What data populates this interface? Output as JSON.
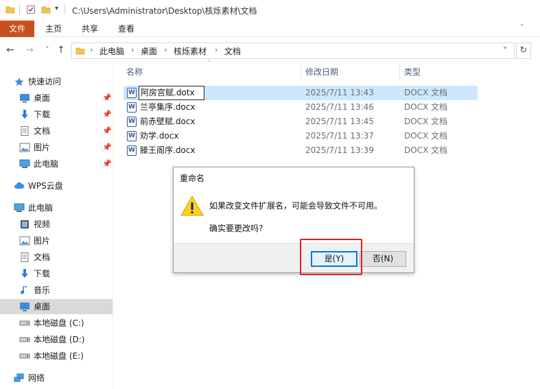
{
  "window": {
    "title_path": "C:\\Users\\Administrator\\Desktop\\核烁素材\\文档"
  },
  "ribbon": {
    "tabs": [
      "文件",
      "主页",
      "共享",
      "查看"
    ]
  },
  "address": {
    "crumbs": [
      "此电脑",
      "桌面",
      "核烁素材",
      "文档"
    ]
  },
  "sidebar": {
    "items": [
      {
        "label": "快速访问",
        "icon": "star-icon",
        "pinned": false
      },
      {
        "label": "桌面",
        "icon": "desktop-icon",
        "pinned": true
      },
      {
        "label": "下载",
        "icon": "download-icon",
        "pinned": true
      },
      {
        "label": "文档",
        "icon": "document-icon",
        "pinned": true
      },
      {
        "label": "图片",
        "icon": "picture-icon",
        "pinned": true
      },
      {
        "label": "此电脑",
        "icon": "computer-icon",
        "pinned": true
      },
      {
        "label": "WPS云盘",
        "icon": "cloud-icon",
        "pinned": false
      },
      {
        "label": "此电脑",
        "icon": "computer-icon",
        "pinned": false
      },
      {
        "label": "视频",
        "icon": "video-icon",
        "pinned": false
      },
      {
        "label": "图片",
        "icon": "picture-icon",
        "pinned": false
      },
      {
        "label": "文档",
        "icon": "document-icon",
        "pinned": false
      },
      {
        "label": "下载",
        "icon": "download-icon",
        "pinned": false
      },
      {
        "label": "音乐",
        "icon": "music-icon",
        "pinned": false
      },
      {
        "label": "桌面",
        "icon": "desktop-icon",
        "pinned": false
      },
      {
        "label": "本地磁盘 (C:)",
        "icon": "drive-icon",
        "pinned": false
      },
      {
        "label": "本地磁盘 (D:)",
        "icon": "drive-icon",
        "pinned": false
      },
      {
        "label": "本地磁盘 (E:)",
        "icon": "drive-icon",
        "pinned": false
      },
      {
        "label": "网络",
        "icon": "network-icon",
        "pinned": false
      }
    ],
    "selected_label": "桌面"
  },
  "file_list": {
    "columns": {
      "name": "名称",
      "date": "修改日期",
      "type": "类型"
    },
    "rows": [
      {
        "name": "阿房宫赋.dotx",
        "date": "2025/7/11 13:43",
        "type": "DOCX 文档",
        "renaming": true
      },
      {
        "name": "兰亭集序.docx",
        "date": "2025/7/11 13:46",
        "type": "DOCX 文档"
      },
      {
        "name": "前赤壁赋.docx",
        "date": "2025/7/11 13:45",
        "type": "DOCX 文档"
      },
      {
        "name": "劝学.docx",
        "date": "2025/7/11 13:37",
        "type": "DOCX 文档"
      },
      {
        "name": "滕王阁序.docx",
        "date": "2025/7/11 13:39",
        "type": "DOCX 文档"
      }
    ]
  },
  "dialog": {
    "title": "重命名",
    "message": "如果改变文件扩展名，可能会导致文件不可用。",
    "question": "确实要更改吗?",
    "yes_label": "是(Y)",
    "no_label": "否(N)"
  },
  "colors": {
    "file_tab": "#c8501f",
    "selection": "#cce8ff",
    "highlight": "#e02020"
  }
}
